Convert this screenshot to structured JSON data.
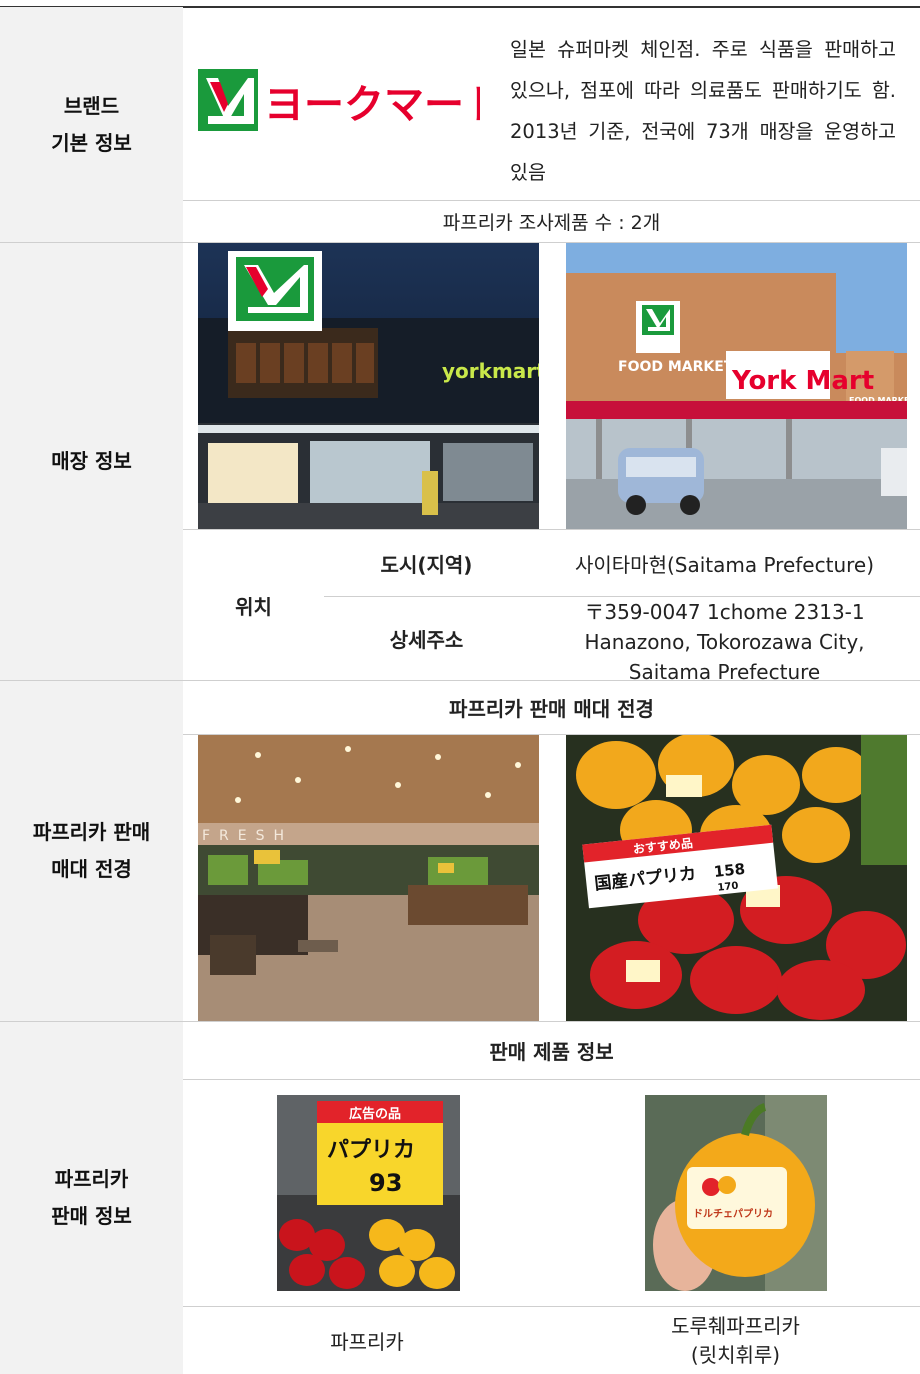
{
  "brand": {
    "label_line1": "브랜드",
    "label_line2": "기본 정보",
    "logo_text": "ヨークマート",
    "description": "일본 슈퍼마켓 체인점. 주로 식품을 판매하고 있으나, 점포에 따라 의료품도 판매하기도 함. 2013년 기준, 전국에 73개 매장을 운영하고 있음",
    "survey_count": "파프리카 조사제품 수 : 2개"
  },
  "store": {
    "label": "매장 정보",
    "photo1_sign": "yorkmart",
    "photo2_sign_fm": "FOOD MARKET",
    "photo2_sign_ym": "York Mart",
    "photo2_sign_fm2": "FOOD MARKET",
    "location_label": "위치",
    "city_label": "도시(지역)",
    "city_value": "사이타마현(Saitama Prefecture)",
    "address_label": "상세주소",
    "address_line1": "〒359-0047 1chome 2313-1",
    "address_line2": "Hanazono, Tokorozawa City,",
    "address_line3": "Saitama Prefecture"
  },
  "display": {
    "label_line1": "파프리카 판매",
    "label_line2": "매대 전경",
    "header": "파프리카 판매 매대 전경",
    "photo1_sign": "FRESH",
    "photo2_tag_top": "おすすめ品",
    "photo2_tag_main": "国産パプリカ",
    "photo2_tag_price": "158",
    "photo2_tag_price2": "170"
  },
  "products": {
    "label_line1": "파프리카",
    "label_line2": "판매 정보",
    "header": "판매 제품 정보",
    "item1_name": "파프리카",
    "item1_tag_top": "広告の品",
    "item1_tag_main": "パプリカ",
    "item1_tag_price": "93",
    "item2_name_line1": "도루췌파프리카",
    "item2_name_line2": "(릿치휘루)",
    "item2_label": "ドルチェパプリカ"
  },
  "colors": {
    "logo_green": "#1a9a3c",
    "logo_red": "#e6002d",
    "label_bg": "#f2f2f2"
  }
}
